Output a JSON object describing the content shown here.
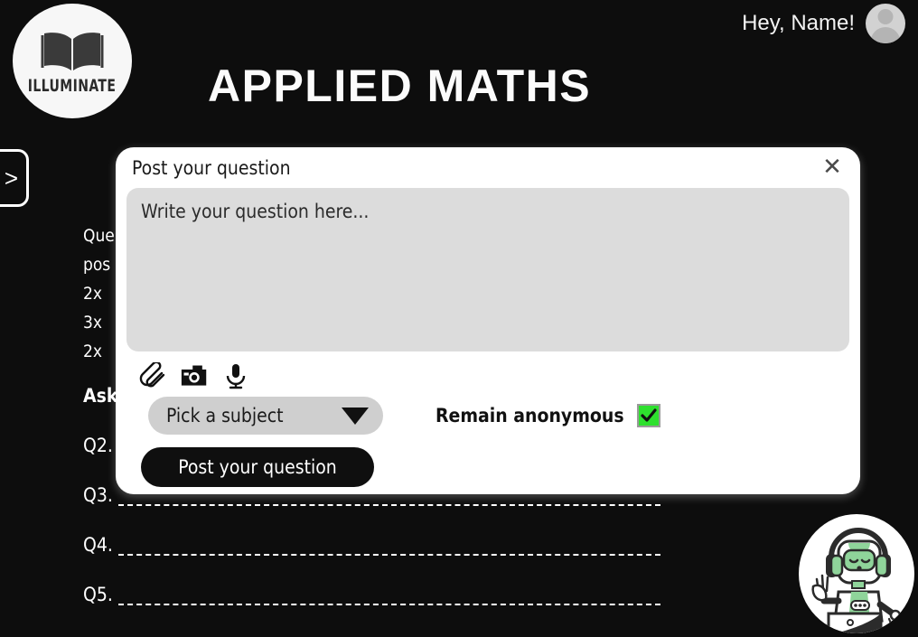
{
  "header": {
    "logo_word": "ILLUMINATE",
    "logo_icon": "open-book-icon",
    "page_title": "APPLIED MATHS",
    "greeting": "Hey, Name!",
    "avatar_icon": "user-avatar-icon"
  },
  "sidebar_toggle": {
    "label": ">"
  },
  "background_sheet": {
    "lines": [
      "Que",
      "pos",
      "2x ",
      "3x ",
      "2x "
    ],
    "ask_label": "Ask",
    "questions": [
      {
        "label": "Q2."
      },
      {
        "label": "Q3."
      },
      {
        "label": "Q4."
      },
      {
        "label": "Q5."
      }
    ]
  },
  "modal": {
    "title": "Post your question",
    "close_label": "✕",
    "textarea": {
      "value": "",
      "placeholder": "Write your question here..."
    },
    "attachments": [
      {
        "name": "paperclip-icon",
        "label": "Attach file"
      },
      {
        "name": "camera-icon",
        "label": "Take photo"
      },
      {
        "name": "microphone-icon",
        "label": "Record audio"
      }
    ],
    "subject_select": {
      "selected": "Pick a subject",
      "caret": "chevron-down-icon"
    },
    "anonymous": {
      "label": "Remain anonymous",
      "checked": true,
      "check_glyph": "✔",
      "color": "#2ee02e"
    },
    "submit_label": "Post your question"
  },
  "mascot": {
    "name": "robot-assistant-icon"
  },
  "colors": {
    "background": "#0d0d0d",
    "modal_bg": "#ffffff",
    "textarea_bg": "#dcdcdc",
    "select_bg": "#cfcfcf",
    "accent_green": "#2ee02e",
    "text_light": "#ffffff"
  }
}
